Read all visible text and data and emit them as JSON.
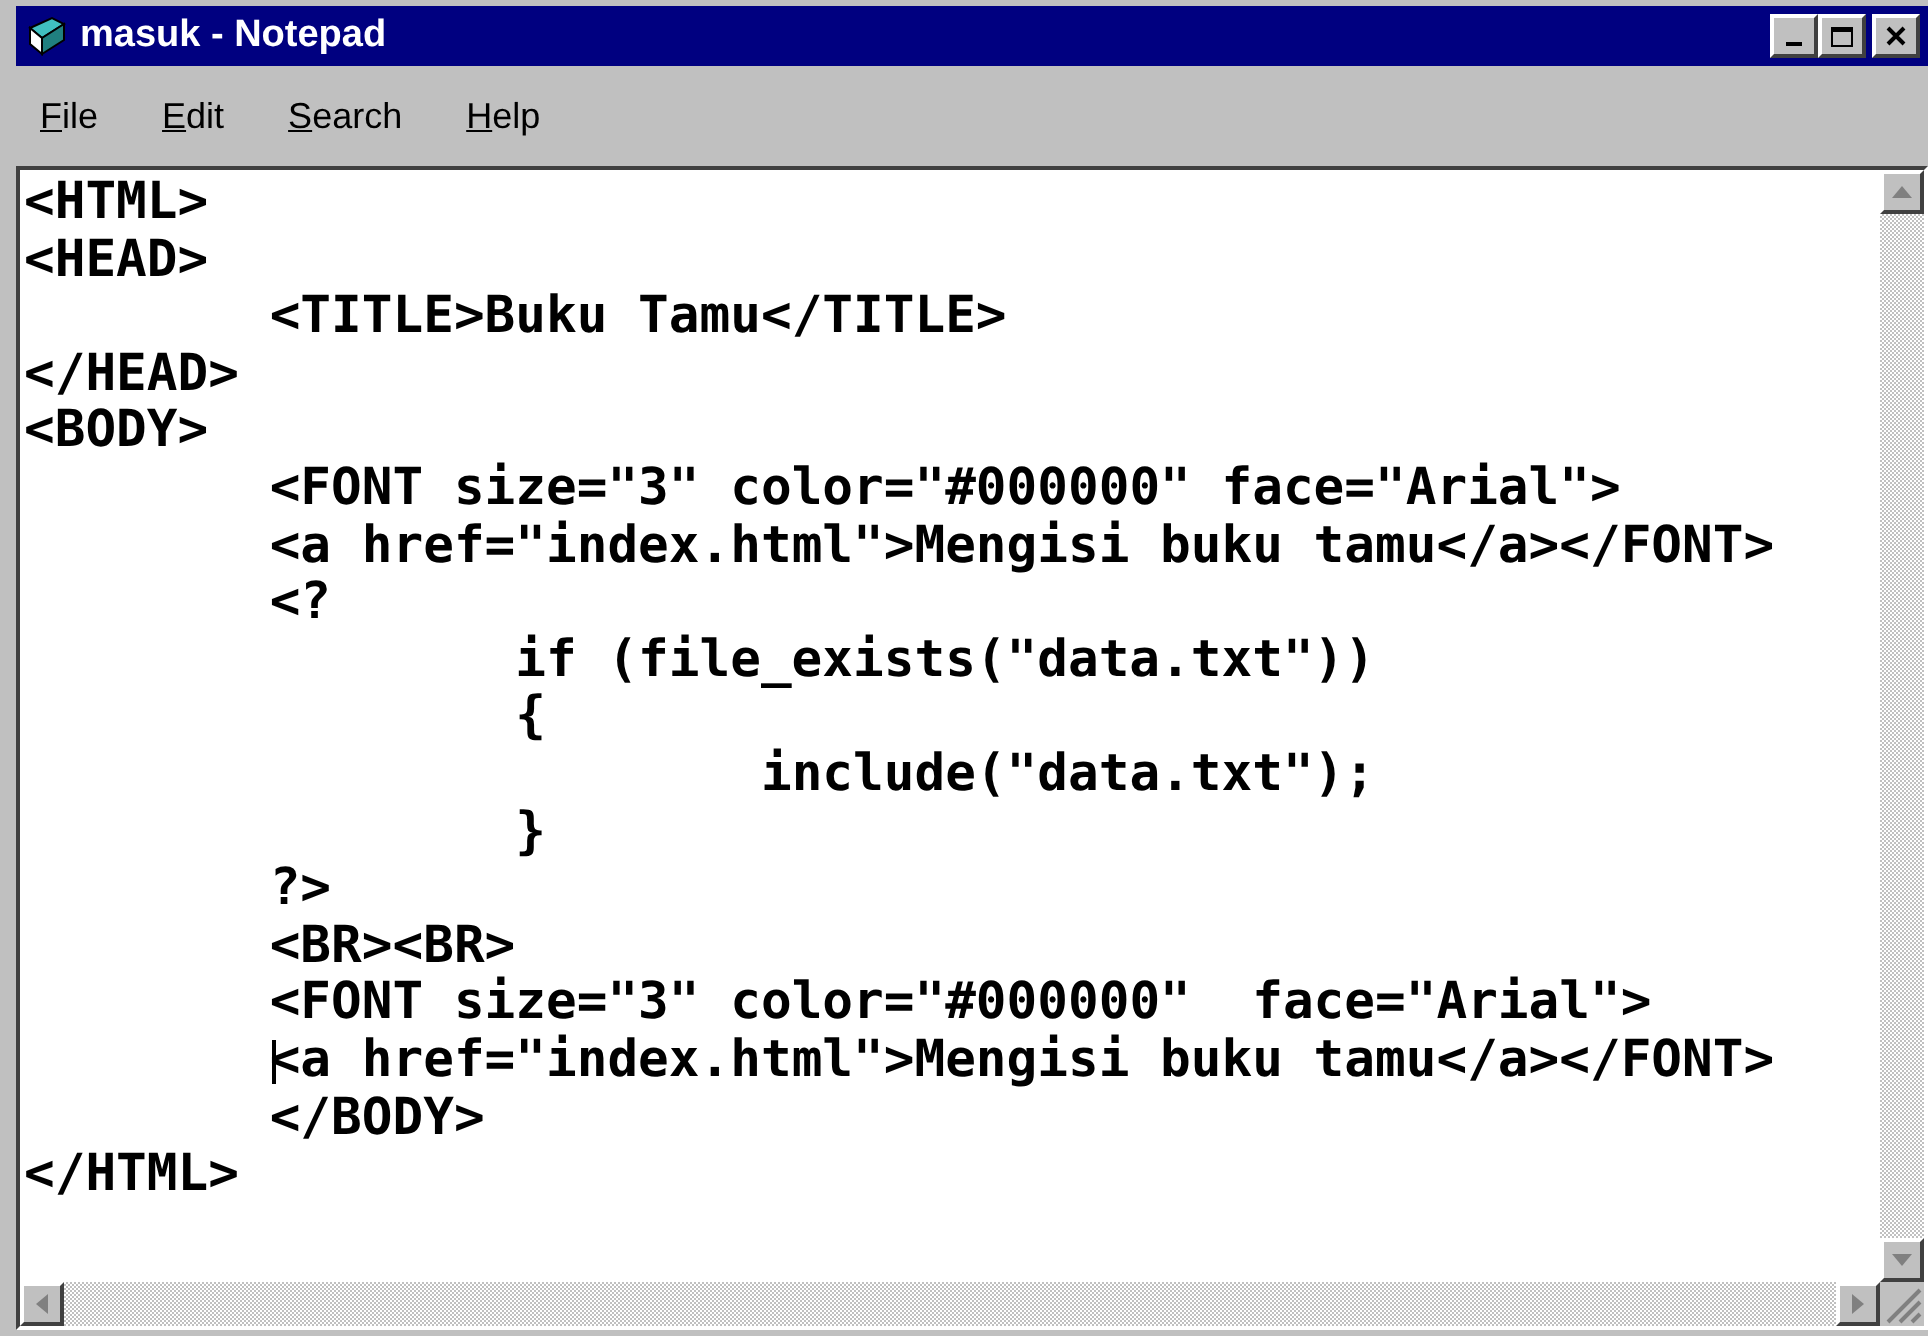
{
  "window": {
    "title": "masuk - Notepad"
  },
  "menu": [
    {
      "label": "File"
    },
    {
      "label": "Edit"
    },
    {
      "label": "Search"
    },
    {
      "label": "Help"
    }
  ],
  "lines": [
    {
      "text": "<HTML>",
      "cursor": false
    },
    {
      "text": "<HEAD>",
      "cursor": false
    },
    {
      "text": "\t<TITLE>Buku Tamu</TITLE>",
      "cursor": false
    },
    {
      "text": "</HEAD>",
      "cursor": false
    },
    {
      "text": "<BODY>",
      "cursor": false
    },
    {
      "text": "\t<FONT size=\"3\" color=\"#000000\" face=\"Arial\">",
      "cursor": false
    },
    {
      "text": "\t<a href=\"index.html\">Mengisi buku tamu</a></FONT>",
      "cursor": false
    },
    {
      "text": "\t<?",
      "cursor": false
    },
    {
      "text": "\t\tif (file_exists(\"data.txt\"))",
      "cursor": false
    },
    {
      "text": "\t\t{",
      "cursor": false
    },
    {
      "text": "\t\t\tinclude(\"data.txt\");",
      "cursor": false
    },
    {
      "text": "\t\t}",
      "cursor": false
    },
    {
      "text": "\t?>",
      "cursor": false
    },
    {
      "text": "\t<BR><BR>",
      "cursor": false
    },
    {
      "text": "\t<FONT size=\"3\" color=\"#000000\"  face=\"Arial\">",
      "cursor": false
    },
    {
      "text": "\t<a href=\"index.html\">Mengisi buku tamu</a></FONT>",
      "cursor": true
    },
    {
      "text": "\t</BODY>",
      "cursor": false
    },
    {
      "text": "</HTML>",
      "cursor": false
    }
  ]
}
